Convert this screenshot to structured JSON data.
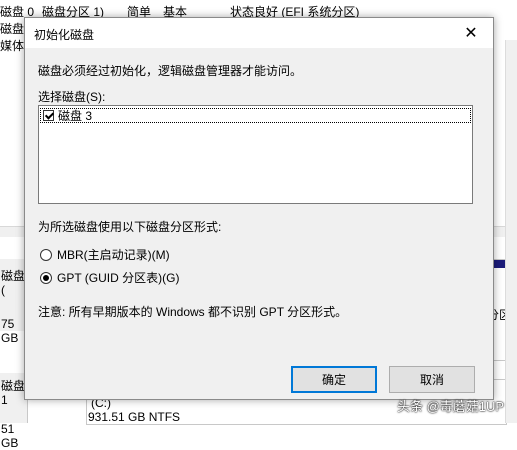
{
  "background": {
    "rows": [
      {
        "c1": "磁盘 0",
        "c2": "磁盘分区 1)",
        "c3": "简单",
        "c4": "基本",
        "c5": "状态良好 (EFI 系统分区)"
      },
      {
        "c1": "磁盘 0",
        "c2": "",
        "c3": "",
        "c4": "",
        "c5": ""
      },
      {
        "c1": "媒体 (",
        "c2": "",
        "c3": "",
        "c4": "",
        "c5": ""
      }
    ],
    "disk_labels": [
      "磁盘 (",
      "75 GB",
      "磁盘 1",
      "51 GB"
    ],
    "right_fragment": "分区",
    "bottom_fragment_1": "(C:)",
    "bottom_fragment_2": "931.51 GB NTFS"
  },
  "dialog": {
    "title": "初始化磁盘",
    "close_glyph": "✕",
    "description": "磁盘必须经过初始化，逻辑磁盘管理器才能访问。",
    "select_label": "选择磁盘(S):",
    "disks": [
      {
        "label": "磁盘 3",
        "checked": true
      }
    ],
    "partition_label": "为所选磁盘使用以下磁盘分区形式:",
    "options": [
      {
        "label": "MBR(主启动记录)(M)",
        "checked": false
      },
      {
        "label": "GPT (GUID 分区表)(G)",
        "checked": true
      }
    ],
    "note": "注意: 所有早期版本的 Windows 都不识别 GPT 分区形式。",
    "ok_label": "确定",
    "cancel_label": "取消"
  },
  "watermark": "头条 @毒蘑菇1UP",
  "colors": {
    "accent": "#0078d7",
    "partition_bar": "#1c1c7a",
    "dialog_bg": "#f0f0f0"
  }
}
